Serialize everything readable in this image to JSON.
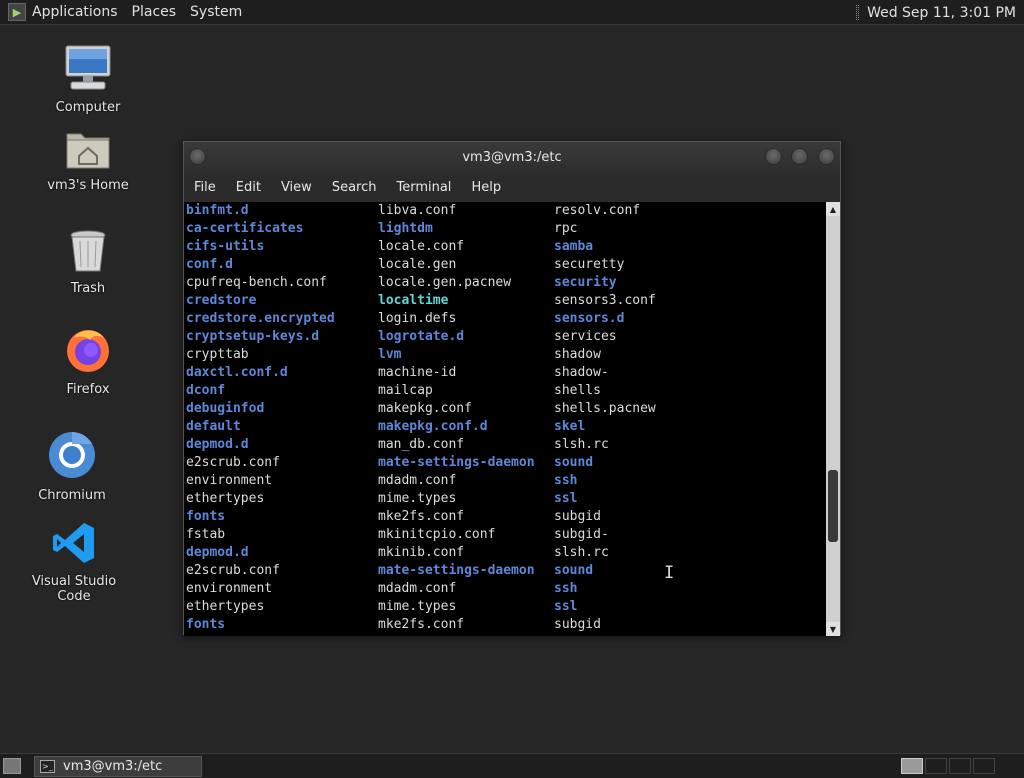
{
  "top_panel": {
    "menus": [
      "Applications",
      "Places",
      "System"
    ],
    "clock": "Wed Sep 11, 3:01 PM"
  },
  "desktop_icons": [
    {
      "label": "Computer",
      "icon": "computer-icon"
    },
    {
      "label": "vm3's Home",
      "icon": "home-folder-icon"
    },
    {
      "label": "Trash",
      "icon": "trash-icon"
    },
    {
      "label": "Firefox",
      "icon": "firefox-icon"
    },
    {
      "label": "Chromium",
      "icon": "chromium-icon"
    },
    {
      "label": "Visual Studio Code",
      "icon": "vscode-icon"
    }
  ],
  "terminal": {
    "title": "vm3@vm3:/etc",
    "menus": [
      "File",
      "Edit",
      "View",
      "Search",
      "Terminal",
      "Help"
    ],
    "colors": {
      "dir": "#5f87d7",
      "link": "#5fd7d7",
      "file": "#dcdcdc"
    },
    "rows": [
      [
        {
          "t": "binfmt.d",
          "k": "dir"
        },
        {
          "t": "libva.conf",
          "k": "file"
        },
        {
          "t": "resolv.conf",
          "k": "file"
        }
      ],
      [
        {
          "t": "ca-certificates",
          "k": "dir"
        },
        {
          "t": "lightdm",
          "k": "dir"
        },
        {
          "t": "rpc",
          "k": "file"
        }
      ],
      [
        {
          "t": "cifs-utils",
          "k": "dir"
        },
        {
          "t": "locale.conf",
          "k": "file"
        },
        {
          "t": "samba",
          "k": "dir"
        }
      ],
      [
        {
          "t": "conf.d",
          "k": "dir"
        },
        {
          "t": "locale.gen",
          "k": "file"
        },
        {
          "t": "securetty",
          "k": "file"
        }
      ],
      [
        {
          "t": "cpufreq-bench.conf",
          "k": "file"
        },
        {
          "t": "locale.gen.pacnew",
          "k": "file"
        },
        {
          "t": "security",
          "k": "dir"
        }
      ],
      [
        {
          "t": "credstore",
          "k": "dir"
        },
        {
          "t": "localtime",
          "k": "link"
        },
        {
          "t": "sensors3.conf",
          "k": "file"
        }
      ],
      [
        {
          "t": "credstore.encrypted",
          "k": "dir"
        },
        {
          "t": "login.defs",
          "k": "file"
        },
        {
          "t": "sensors.d",
          "k": "dir"
        }
      ],
      [
        {
          "t": "cryptsetup-keys.d",
          "k": "dir"
        },
        {
          "t": "logrotate.d",
          "k": "dir"
        },
        {
          "t": "services",
          "k": "file"
        }
      ],
      [
        {
          "t": "crypttab",
          "k": "file"
        },
        {
          "t": "lvm",
          "k": "dir"
        },
        {
          "t": "shadow",
          "k": "file"
        }
      ],
      [
        {
          "t": "daxctl.conf.d",
          "k": "dir"
        },
        {
          "t": "machine-id",
          "k": "file"
        },
        {
          "t": "shadow-",
          "k": "file"
        }
      ],
      [
        {
          "t": "dconf",
          "k": "dir"
        },
        {
          "t": "mailcap",
          "k": "file"
        },
        {
          "t": "shells",
          "k": "file"
        }
      ],
      [
        {
          "t": "debuginfod",
          "k": "dir"
        },
        {
          "t": "makepkg.conf",
          "k": "file"
        },
        {
          "t": "shells.pacnew",
          "k": "file"
        }
      ],
      [
        {
          "t": "default",
          "k": "dir"
        },
        {
          "t": "makepkg.conf.d",
          "k": "dir"
        },
        {
          "t": "skel",
          "k": "dir"
        }
      ],
      [
        {
          "t": "depmod.d",
          "k": "dir"
        },
        {
          "t": "man_db.conf",
          "k": "file"
        },
        {
          "t": "slsh.rc",
          "k": "file"
        }
      ],
      [
        {
          "t": "e2scrub.conf",
          "k": "file"
        },
        {
          "t": "mate-settings-daemon",
          "k": "dir"
        },
        {
          "t": "sound",
          "k": "dir"
        }
      ],
      [
        {
          "t": "environment",
          "k": "file"
        },
        {
          "t": "mdadm.conf",
          "k": "file"
        },
        {
          "t": "ssh",
          "k": "dir"
        }
      ],
      [
        {
          "t": "ethertypes",
          "k": "file"
        },
        {
          "t": "mime.types",
          "k": "file"
        },
        {
          "t": "ssl",
          "k": "dir"
        }
      ],
      [
        {
          "t": "fonts",
          "k": "dir"
        },
        {
          "t": "mke2fs.conf",
          "k": "file"
        },
        {
          "t": "subgid",
          "k": "file"
        }
      ],
      [
        {
          "t": "fstab",
          "k": "file"
        },
        {
          "t": "mkinitcpio.conf",
          "k": "file"
        },
        {
          "t": "subgid-",
          "k": "file"
        }
      ],
      [
        {
          "t": "depmod.d",
          "k": "dir"
        },
        {
          "t": "mkinib.conf",
          "k": "file"
        },
        {
          "t": "slsh.rc",
          "k": "file"
        }
      ],
      [
        {
          "t": "e2scrub.conf",
          "k": "file"
        },
        {
          "t": "mate-settings-daemon",
          "k": "dir"
        },
        {
          "t": "sound",
          "k": "dir"
        }
      ],
      [
        {
          "t": "environment",
          "k": "file"
        },
        {
          "t": "mdadm.conf",
          "k": "file"
        },
        {
          "t": "ssh",
          "k": "dir"
        }
      ],
      [
        {
          "t": "ethertypes",
          "k": "file"
        },
        {
          "t": "mime.types",
          "k": "file"
        },
        {
          "t": "ssl",
          "k": "dir"
        }
      ],
      [
        {
          "t": "fonts",
          "k": "dir"
        },
        {
          "t": "mke2fs.conf",
          "k": "file"
        },
        {
          "t": "subgid",
          "k": "file"
        }
      ]
    ]
  },
  "taskbar": {
    "window_button": "vm3@vm3:/etc"
  }
}
